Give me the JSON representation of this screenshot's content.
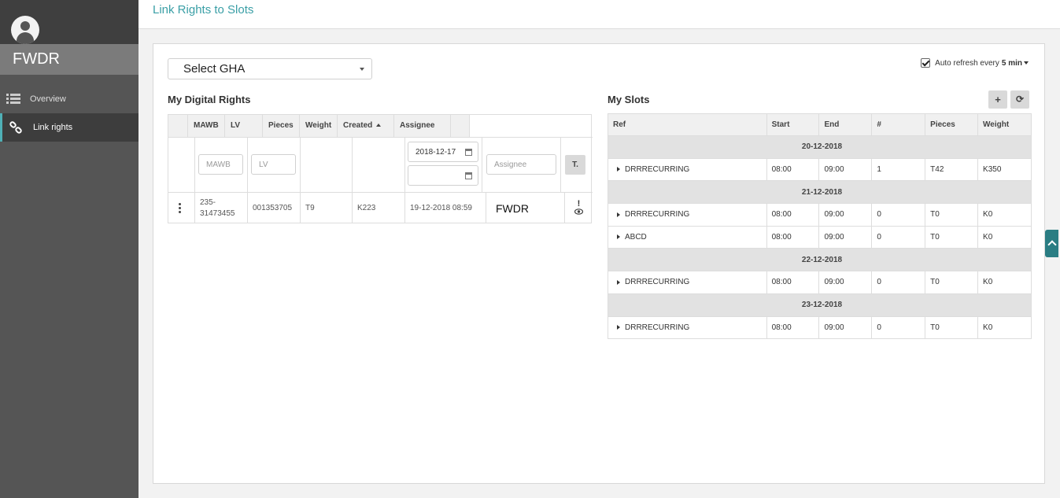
{
  "sidebar": {
    "user": "FWDR",
    "items": [
      {
        "label": "Overview",
        "icon": "list-icon"
      },
      {
        "label": "Link rights",
        "icon": "link-icon"
      }
    ]
  },
  "header": {
    "title": "Link Rights to Slots"
  },
  "toolbar": {
    "gha_select": "Select GHA",
    "auto_refresh_label": "Auto refresh every",
    "auto_refresh_value": "5 min",
    "auto_refresh_checked": true
  },
  "rights": {
    "title": "My Digital Rights",
    "columns": [
      "MAWB",
      "LV",
      "Pieces",
      "Weight",
      "Created",
      "Assignee"
    ],
    "filters": {
      "mawb_placeholder": "MAWB",
      "lv_placeholder": "LV",
      "date_from": "2018-12-17",
      "date_to": "",
      "assignee_placeholder": "Assignee",
      "filter_button": "T."
    },
    "rows": [
      {
        "mawb": "235-31473455",
        "lv": "001353705",
        "pieces": "T9",
        "weight": "K223",
        "created": "19-12-2018 08:59",
        "assignee": "FWDR",
        "alert": "!"
      }
    ]
  },
  "slots": {
    "title": "My Slots",
    "add_button": "+",
    "refresh_button": "⟳",
    "columns": [
      "Ref",
      "Start",
      "End",
      "#",
      "Pieces",
      "Weight"
    ],
    "groups": [
      {
        "date": "20-12-2018",
        "rows": [
          {
            "ref": "DRRRECURRING",
            "start": "08:00",
            "end": "09:00",
            "count": "1",
            "pieces": "T42",
            "weight": "K350"
          }
        ]
      },
      {
        "date": "21-12-2018",
        "rows": [
          {
            "ref": "DRRRECURRING",
            "start": "08:00",
            "end": "09:00",
            "count": "0",
            "pieces": "T0",
            "weight": "K0"
          },
          {
            "ref": "ABCD",
            "start": "08:00",
            "end": "09:00",
            "count": "0",
            "pieces": "T0",
            "weight": "K0"
          }
        ]
      },
      {
        "date": "22-12-2018",
        "rows": [
          {
            "ref": "DRRRECURRING",
            "start": "08:00",
            "end": "09:00",
            "count": "0",
            "pieces": "T0",
            "weight": "K0"
          }
        ]
      },
      {
        "date": "23-12-2018",
        "rows": [
          {
            "ref": "DRRRECURRING",
            "start": "08:00",
            "end": "09:00",
            "count": "0",
            "pieces": "T0",
            "weight": "K0"
          }
        ]
      }
    ]
  },
  "colors": {
    "accent": "#3a9fa6",
    "sidebar": "#555555",
    "scroll_button": "#2a7d83"
  }
}
